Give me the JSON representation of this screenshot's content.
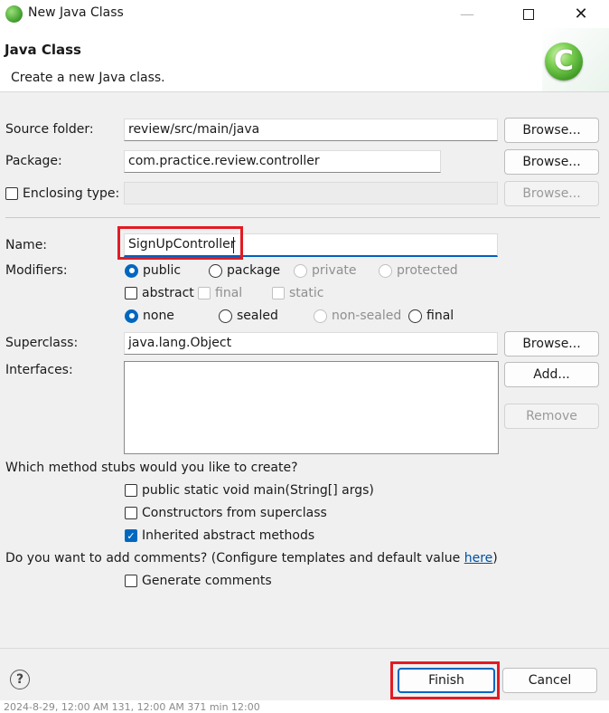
{
  "window": {
    "title": "New Java Class"
  },
  "header": {
    "title": "Java Class",
    "subtitle": "Create a new Java class."
  },
  "source_folder": {
    "label": "Source folder:",
    "value": "review/src/main/java",
    "browse": "Browse..."
  },
  "package": {
    "label": "Package:",
    "value": "com.practice.review.controller",
    "browse": "Browse..."
  },
  "enclosing": {
    "label": "Enclosing type:",
    "value": "",
    "browse": "Browse..."
  },
  "name": {
    "label": "Name:",
    "value": "SignUpController"
  },
  "modifiers": {
    "label": "Modifiers:",
    "access": [
      "public",
      "package",
      "private",
      "protected"
    ],
    "flags": [
      "abstract",
      "final",
      "static"
    ],
    "sealing": [
      "none",
      "sealed",
      "non-sealed",
      "final"
    ]
  },
  "superclass": {
    "label": "Superclass:",
    "value": "java.lang.Object",
    "browse": "Browse..."
  },
  "interfaces": {
    "label": "Interfaces:",
    "add": "Add...",
    "remove": "Remove"
  },
  "stubs": {
    "question": "Which method stubs would you like to create?",
    "items": [
      "public static void main(String[] args)",
      "Constructors from superclass",
      "Inherited abstract methods"
    ]
  },
  "comments": {
    "question_pre": "Do you want to add comments? (Configure templates and default value ",
    "link": "here",
    "question_post": ")",
    "generate": "Generate comments"
  },
  "footer": {
    "finish": "Finish",
    "cancel": "Cancel",
    "help": "?"
  },
  "background_text": "2024-8-29, 12:00 AM 131, 12:00 AM 371 min 12:00",
  "colors": {
    "accent": "#0067c0",
    "highlight": "#e21b23",
    "link": "#0050a0"
  }
}
